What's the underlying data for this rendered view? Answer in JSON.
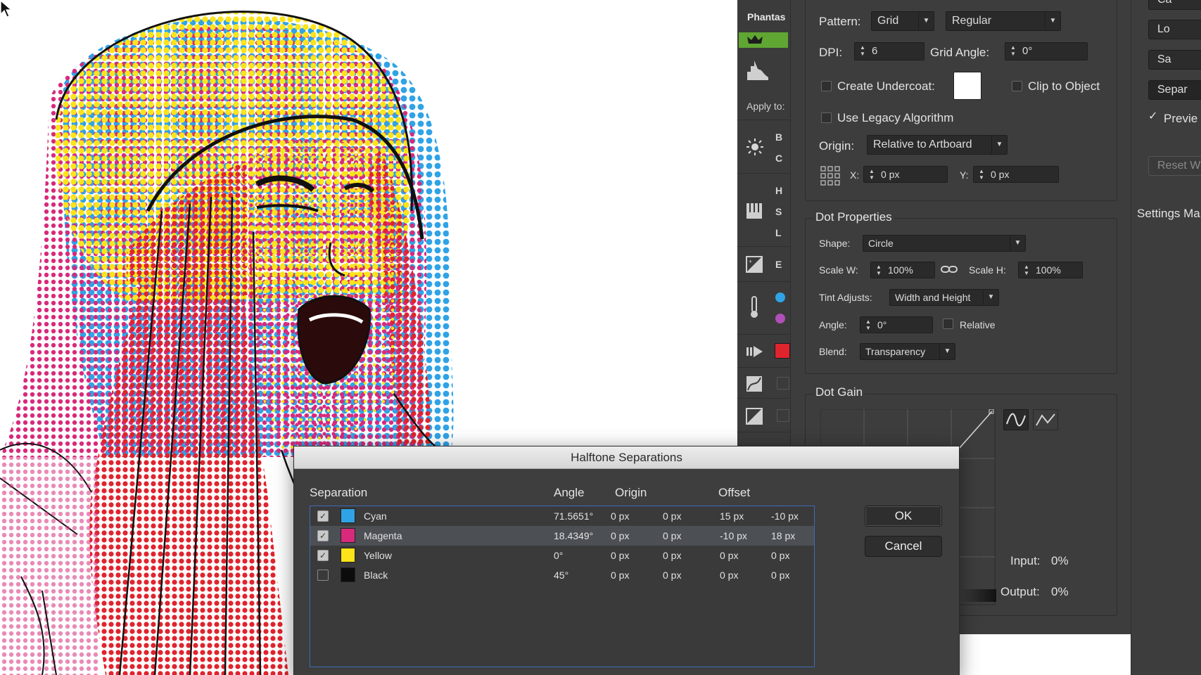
{
  "plugin_strip": {
    "title": "Phantas",
    "apply_to": "Apply to:",
    "letters": [
      "B",
      "C",
      "H",
      "S",
      "L",
      "E"
    ]
  },
  "settings": {
    "pattern_label": "Pattern:",
    "pattern_value": "Grid",
    "pattern_style": "Regular",
    "dpi_label": "DPI:",
    "dpi_value": "6",
    "grid_angle_label": "Grid Angle:",
    "grid_angle_value": "0°",
    "create_undercoat_label": "Create Undercoat:",
    "clip_to_object_label": "Clip to Object",
    "legacy_label": "Use Legacy Algorithm",
    "origin_label": "Origin:",
    "origin_value": "Relative to Artboard",
    "x_label": "X:",
    "x_value": "0 px",
    "y_label": "Y:",
    "y_value": "0 px"
  },
  "dot_properties": {
    "title": "Dot Properties",
    "shape_label": "Shape:",
    "shape_value": "Circle",
    "scale_w_label": "Scale W:",
    "scale_w_value": "100%",
    "scale_h_label": "Scale H:",
    "scale_h_value": "100%",
    "tint_label": "Tint Adjusts:",
    "tint_value": "Width and Height",
    "angle_label": "Angle:",
    "angle_value": "0°",
    "relative_label": "Relative",
    "blend_label": "Blend:",
    "blend_value": "Transparency"
  },
  "dot_gain": {
    "title": "Dot Gain",
    "input_label": "Input:",
    "input_value": "0%",
    "output_label": "Output:",
    "output_value": "0%"
  },
  "right_column": {
    "btn1": "Ca",
    "btn2": "Lo",
    "btn3": "Sa",
    "btn4": "Separ",
    "preview_label": "Previe",
    "reset_label": "Reset W",
    "settings_manager": "Settings Ma"
  },
  "dialog": {
    "title": "Halftone Separations",
    "columns": {
      "separation": "Separation",
      "angle": "Angle",
      "origin": "Origin",
      "offset": "Offset"
    },
    "ok_label": "OK",
    "cancel_label": "Cancel",
    "rows": [
      {
        "name": "Cyan",
        "color": "#2fa3e6",
        "checked": true,
        "angle": "71.5651°",
        "origin_x": "0 px",
        "origin_y": "0 px",
        "offset_x": "15 px",
        "offset_y": "-10 px"
      },
      {
        "name": "Magenta",
        "color": "#d72a7c",
        "checked": true,
        "angle": "18.4349°",
        "origin_x": "0 px",
        "origin_y": "0 px",
        "offset_x": "-10 px",
        "offset_y": "18 px"
      },
      {
        "name": "Yellow",
        "color": "#fbe41a",
        "checked": true,
        "angle": "0°",
        "origin_x": "0 px",
        "origin_y": "0 px",
        "offset_x": "0 px",
        "offset_y": "0 px"
      },
      {
        "name": "Black",
        "color": "#0c0c0c",
        "checked": false,
        "angle": "45°",
        "origin_x": "0 px",
        "origin_y": "0 px",
        "offset_x": "0 px",
        "offset_y": "0 px"
      }
    ]
  }
}
